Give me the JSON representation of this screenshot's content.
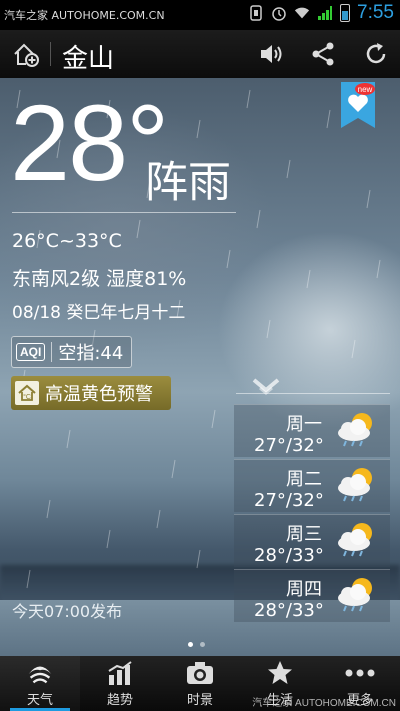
{
  "status_bar": {
    "watermark": "汽车之家 AUTOHOME.COM.CN",
    "time": "7:55"
  },
  "header": {
    "city": "金山"
  },
  "current": {
    "temperature": "28°",
    "condition": "阵雨",
    "temp_range": "26°C~33°C",
    "wind_humidity": "东南风2级 湿度81%",
    "date": "08/18 癸巳年七月十二",
    "aqi_badge": "AQI",
    "aqi_text": "空指:44",
    "warning": "高温黄色预警",
    "bookmark_badge": "new"
  },
  "forecast": [
    {
      "day": "周一",
      "temp": "27°/32°",
      "icon": "cloud-rain-sun-icon"
    },
    {
      "day": "周二",
      "temp": "27°/32°",
      "icon": "cloud-rain-sun-icon"
    },
    {
      "day": "周三",
      "temp": "28°/33°",
      "icon": "cloud-rain-sun-icon"
    },
    {
      "day": "周四",
      "temp": "28°/33°",
      "icon": "cloud-rain-sun-icon"
    }
  ],
  "published": "今天07:00发布",
  "bottom_nav": [
    {
      "label": "天气",
      "icon": "weather-icon",
      "active": true
    },
    {
      "label": "趋势",
      "icon": "trend-icon"
    },
    {
      "label": "时景",
      "icon": "camera-icon"
    },
    {
      "label": "生活",
      "icon": "star-icon"
    },
    {
      "label": "更多",
      "icon": "more-icon"
    }
  ],
  "bottom_watermark": "汽车之家 AUTOHOME.COM.CN",
  "colors": {
    "accent": "#1e9be0",
    "warning_bg": "#8c7f34"
  }
}
